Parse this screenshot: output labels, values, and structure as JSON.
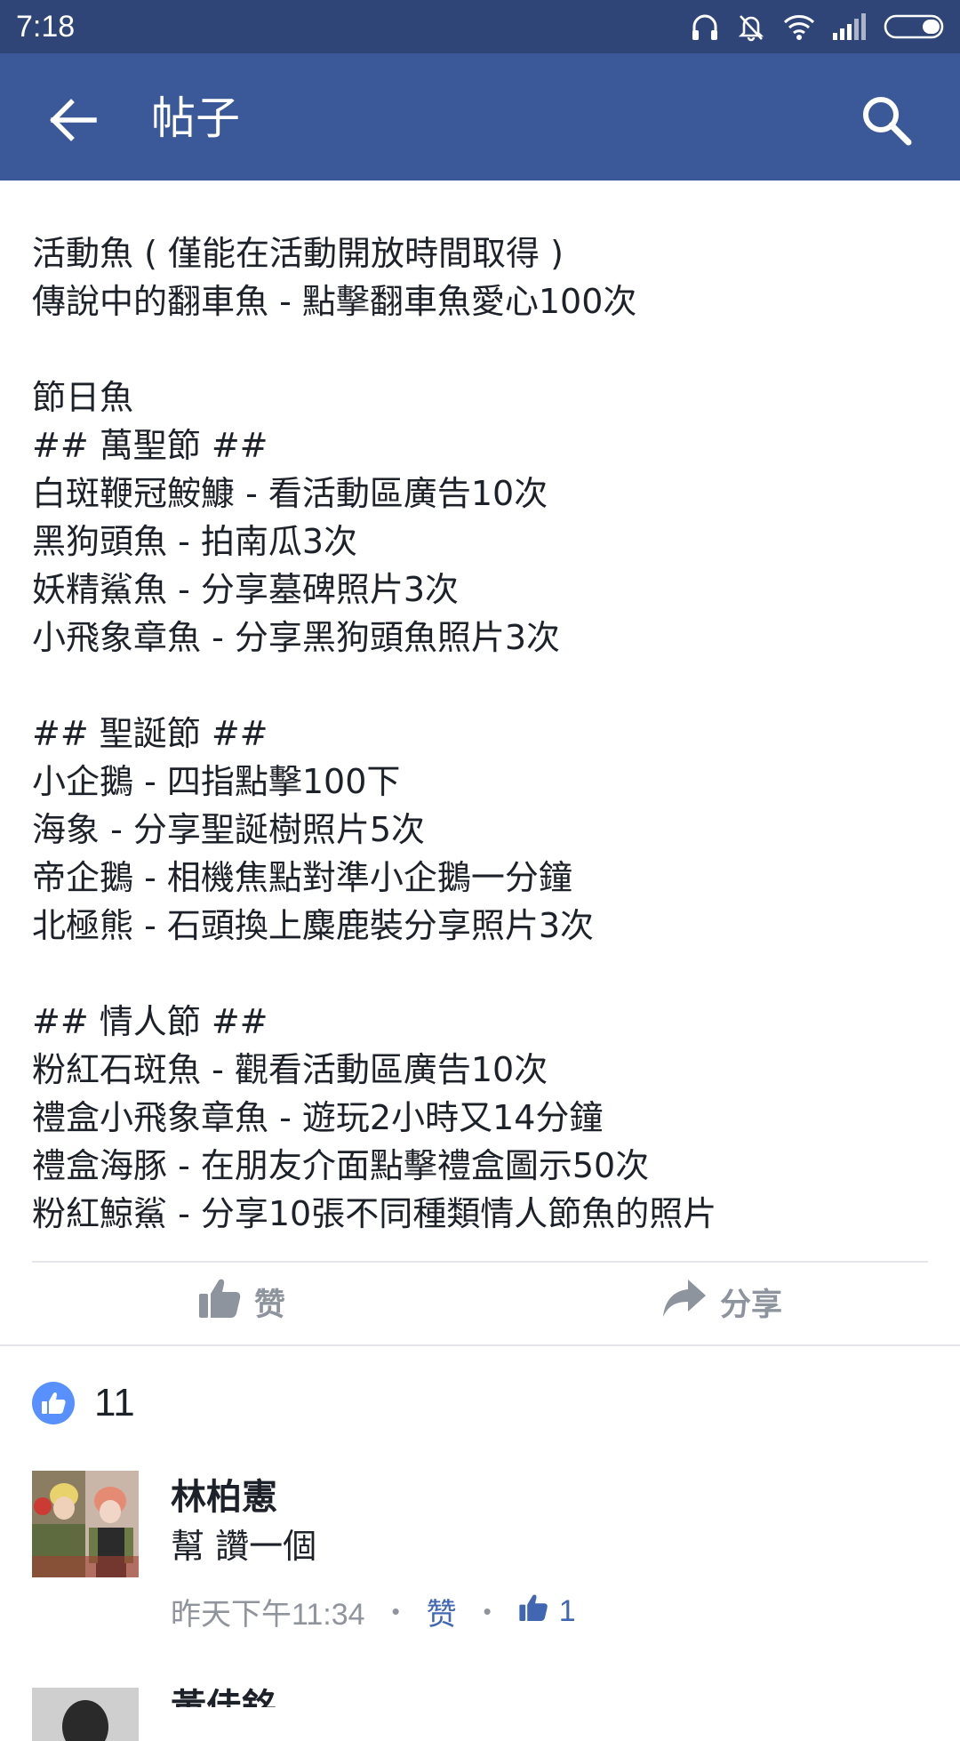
{
  "status_bar": {
    "time": "7:18",
    "icons": [
      "headphones-icon",
      "bell-muted-icon",
      "wifi-icon",
      "signal-icon",
      "battery-icon"
    ]
  },
  "app_bar": {
    "title": "帖子",
    "back_icon": "arrow-left-icon",
    "search_icon": "search-icon",
    "background": "#3b5998"
  },
  "post": {
    "lines": [
      "活動魚 ( 僅能在活動開放時間取得 )",
      "傳說中的翻車魚 - 點擊翻車魚愛心100次",
      "",
      "節日魚",
      "## 萬聖節 ##",
      "白斑鞭冠鮟鱇 - 看活動區廣告10次",
      "黑狗頭魚 - 拍南瓜3次",
      "妖精鯊魚 - 分享墓碑照片3次",
      "小飛象章魚 - 分享黑狗頭魚照片3次",
      "",
      "## 聖誕節 ##",
      "小企鵝 - 四指點擊100下",
      "海象 - 分享聖誕樹照片5次",
      "帝企鵝 - 相機焦點對準小企鵝一分鐘",
      "北極熊 - 石頭換上麋鹿裝分享照片3次",
      "",
      "## 情人節 ##",
      "粉紅石斑魚 - 觀看活動區廣告10次",
      "禮盒小飛象章魚 - 遊玩2小時又14分鐘",
      "禮盒海豚 - 在朋友介面點擊禮盒圖示50次",
      "粉紅鯨鯊 - 分享10張不同種類情人節魚的照片"
    ]
  },
  "actions": {
    "like_label": "赞",
    "share_label": "分享"
  },
  "reactions": {
    "count": "11",
    "icon": "like-reaction-icon",
    "accent": "#5890ff"
  },
  "comments": [
    {
      "author": "林柏憲",
      "text": "幫 讚一個",
      "time": "昨天下午11:34",
      "like_label": "赞",
      "like_count": "1"
    },
    {
      "author": "黃佳銘"
    }
  ]
}
